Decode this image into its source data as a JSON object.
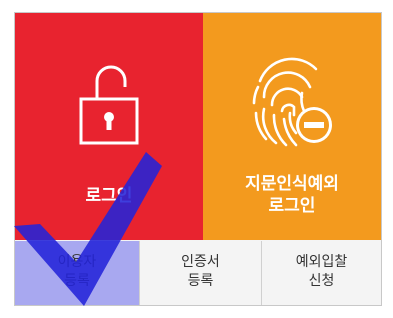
{
  "colors": {
    "login_tile": "#e8232f",
    "fingerprint_tile": "#f39a1e",
    "button_bg": "#f4f4f4",
    "selected_button_bg": "#a8a8f0",
    "checkmark": "#2323d8"
  },
  "tiles": {
    "login": {
      "label": "로그인",
      "icon": "unlocked-padlock-icon"
    },
    "fingerprint": {
      "label": "지문인식예외\n로그인",
      "icon": "fingerprint-minus-icon"
    }
  },
  "buttons": {
    "user_register": "이용자\n등록",
    "cert_register": "인증서\n등록",
    "exception_bid": "예외입찰\n신청"
  },
  "overlay": {
    "icon": "checkmark-icon"
  }
}
